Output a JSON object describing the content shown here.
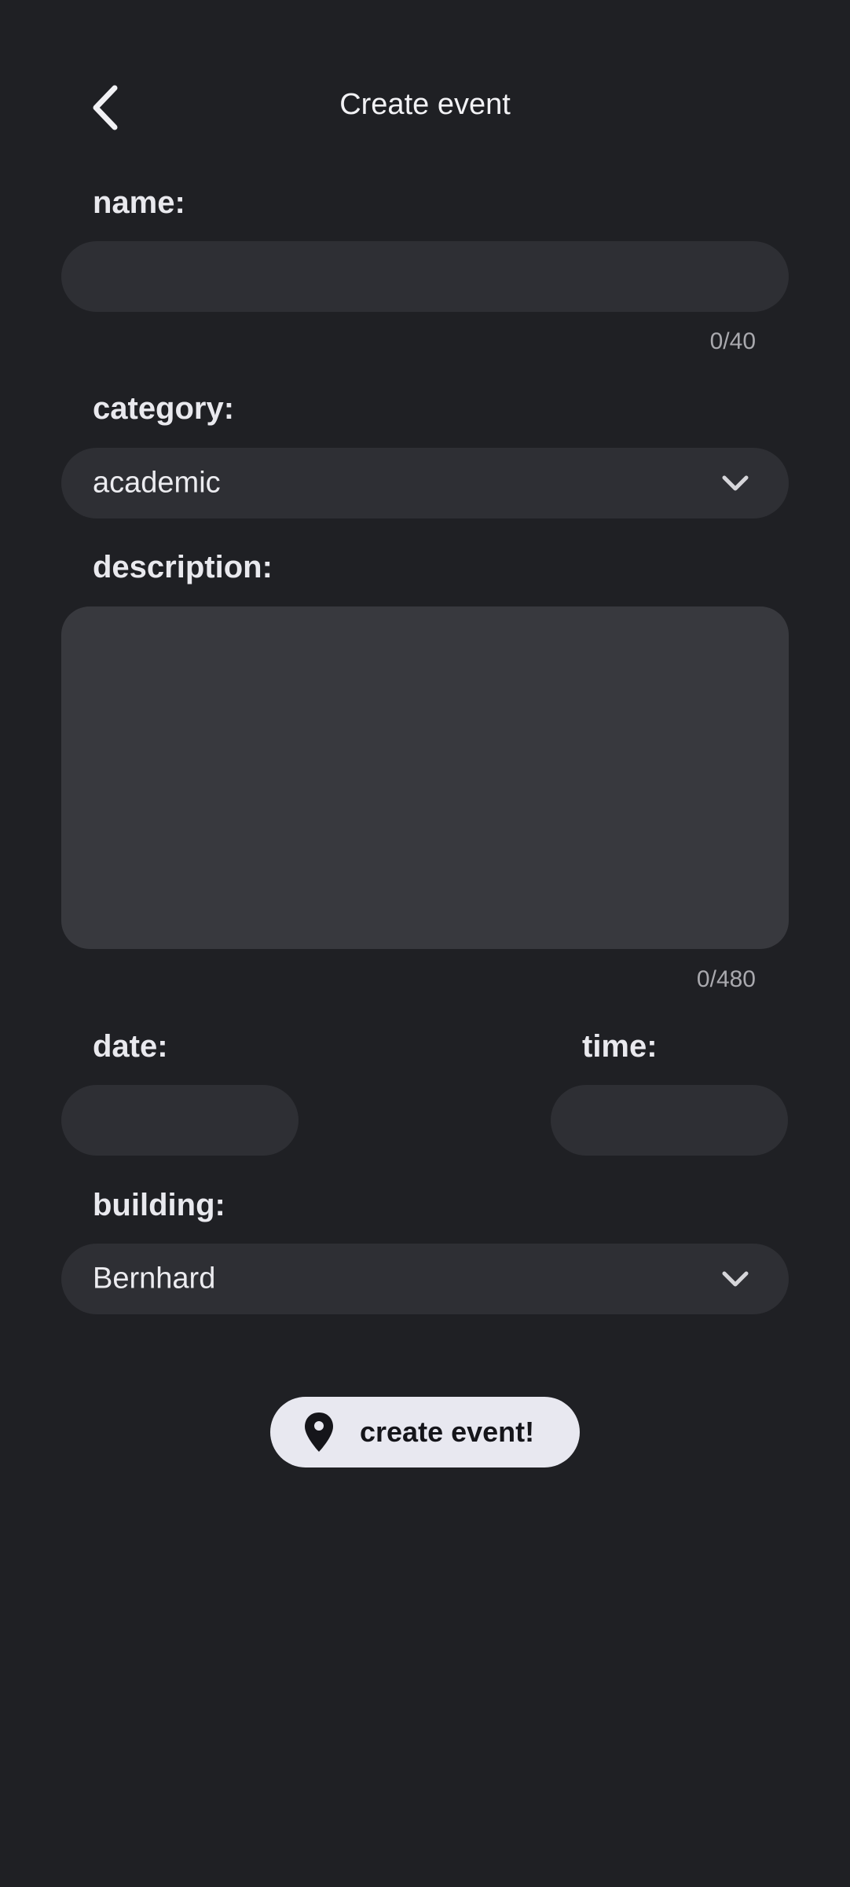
{
  "header": {
    "title": "Create event"
  },
  "form": {
    "name": {
      "label": "name:",
      "value": "",
      "counter": "0/40"
    },
    "category": {
      "label": "category:",
      "value": "academic"
    },
    "description": {
      "label": "description:",
      "value": "",
      "counter": "0/480"
    },
    "date": {
      "label": "date:",
      "value": ""
    },
    "time": {
      "label": "time:",
      "value": ""
    },
    "building": {
      "label": "building:",
      "value": "Bernhard"
    }
  },
  "actions": {
    "create_label": "create event!"
  },
  "icons": {
    "back": "chevron-left-icon",
    "dropdown": "chevron-down-icon",
    "create": "map-pin-icon"
  }
}
